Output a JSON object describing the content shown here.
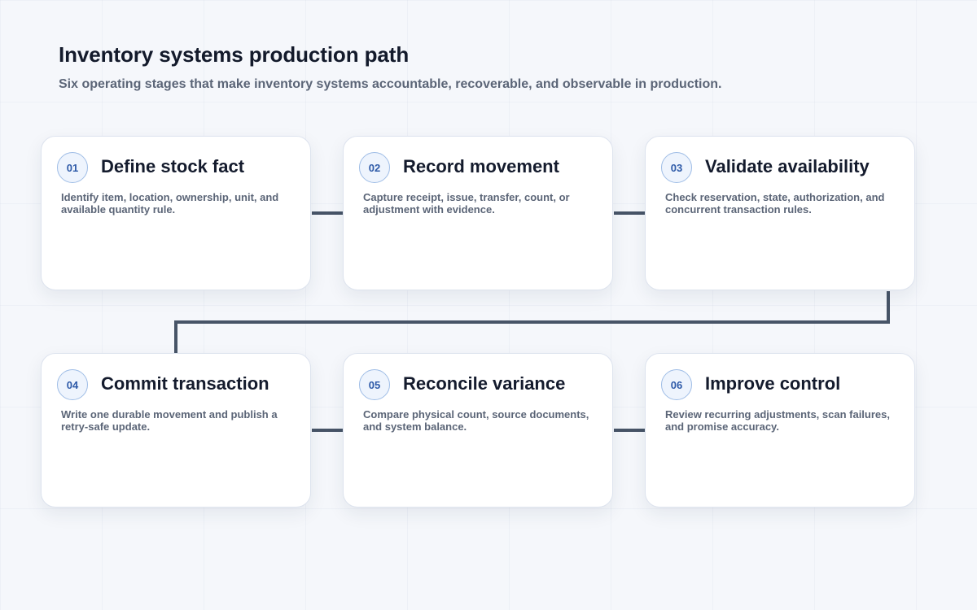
{
  "header": {
    "title": "Inventory systems production path",
    "subtitle": "Six operating stages that make inventory systems accountable, recoverable, and observable in production."
  },
  "colors": {
    "background": "#f5f7fb",
    "card": "#ffffff",
    "connector": "#475467",
    "badge_fill": "#eef4fd",
    "badge_border": "#9fbde6",
    "badge_text": "#2e5aa8",
    "title_text": "#131a2b",
    "body_text": "#5b6577"
  },
  "stages": [
    {
      "number": "01",
      "title": "Define stock fact",
      "description": "Identify item, location, ownership, unit, and available quantity rule."
    },
    {
      "number": "02",
      "title": "Record movement",
      "description": "Capture receipt, issue, transfer, count, or adjustment with evidence."
    },
    {
      "number": "03",
      "title": "Validate availability",
      "description": "Check reservation, state, authorization, and concurrent transaction rules."
    },
    {
      "number": "04",
      "title": "Commit transaction",
      "description": "Write one durable movement and publish a retry-safe update."
    },
    {
      "number": "05",
      "title": "Reconcile variance",
      "description": "Compare physical count, source documents, and system balance."
    },
    {
      "number": "06",
      "title": "Improve control",
      "description": "Review recurring adjustments, scan failures, and promise accuracy."
    }
  ]
}
